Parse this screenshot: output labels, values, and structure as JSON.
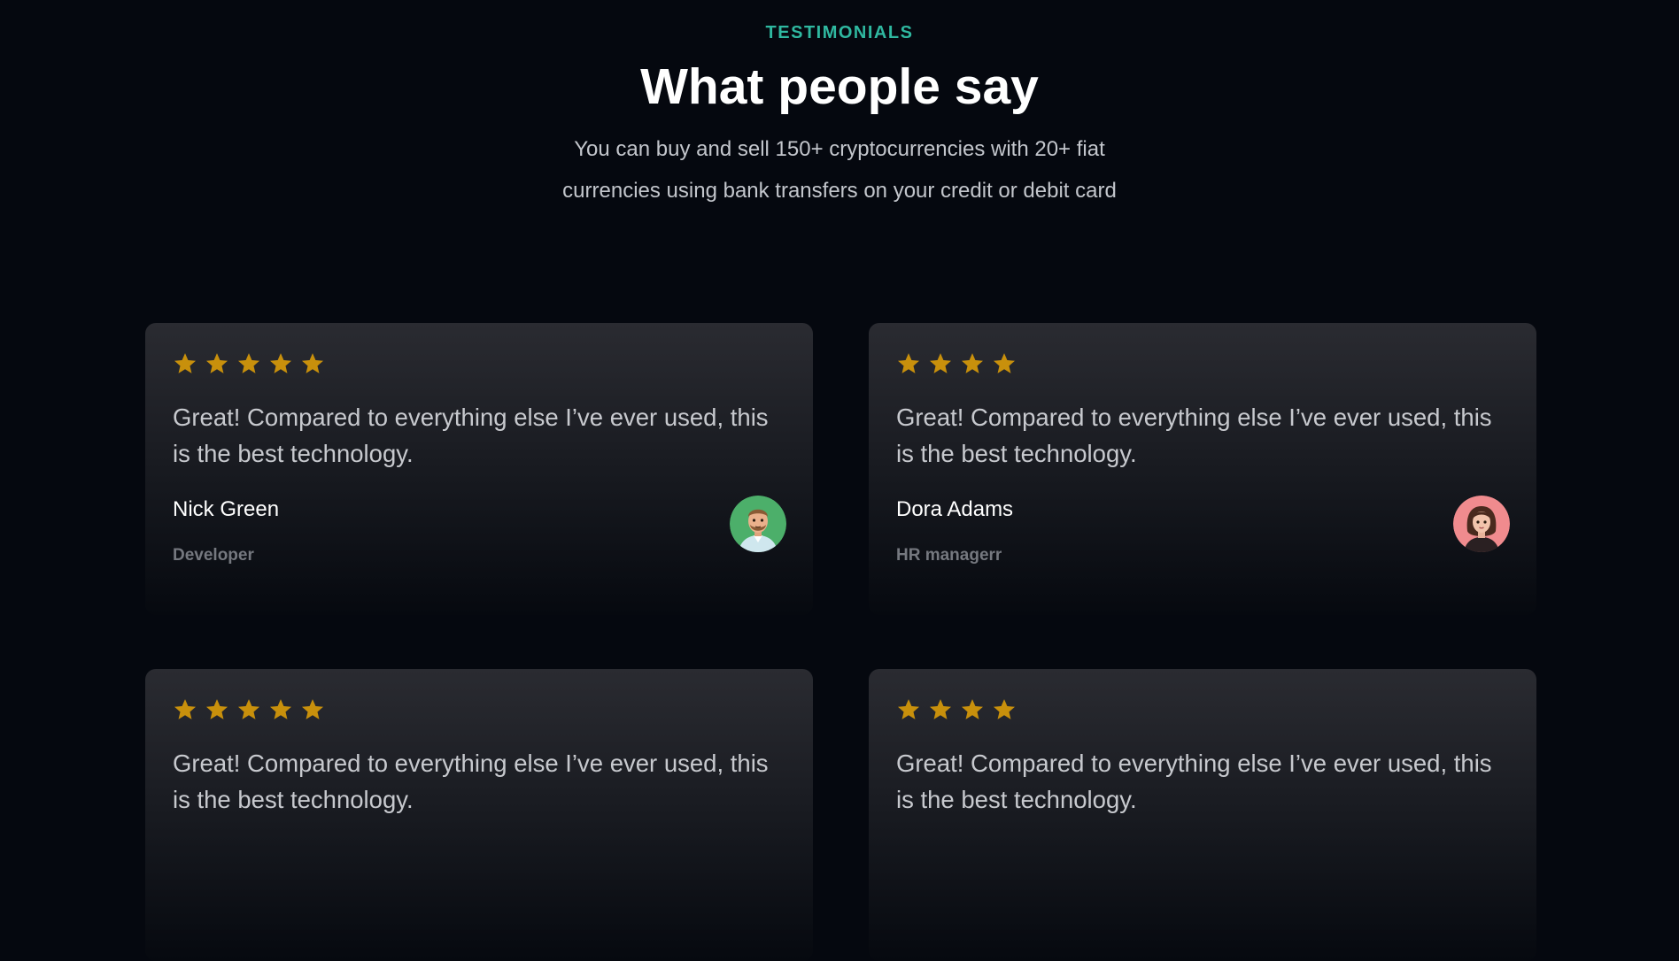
{
  "section": {
    "eyebrow": "TESTIMONIALS",
    "title": "What people say",
    "subtitle": "You can buy and sell 150+ cryptocurrencies with 20+ fiat currencies using bank transfers on your credit or debit card"
  },
  "colors": {
    "background": "#05080f",
    "accent": "#2fb8a0",
    "star": "#c8900c",
    "card_top": "#2a2b31"
  },
  "testimonials": [
    {
      "rating": 5,
      "quote": "Great! Compared to everything else I’ve ever used, this is the best technology.",
      "name": "Nick Green",
      "role": "Developer",
      "avatar_icon": "man-avatar-icon"
    },
    {
      "rating": 4,
      "quote": "Great! Compared to everything else I’ve ever used, this is the best technology.",
      "name": "Dora Adams",
      "role": "HR managerr",
      "avatar_icon": "woman-avatar-icon"
    },
    {
      "rating": 5,
      "quote": "Great! Compared to everything else I’ve ever used, this is the best technology.",
      "name": "",
      "role": "",
      "avatar_icon": ""
    },
    {
      "rating": 4,
      "quote": "Great! Compared to everything else I’ve ever used, this is the best technology.",
      "name": "",
      "role": "",
      "avatar_icon": ""
    }
  ]
}
